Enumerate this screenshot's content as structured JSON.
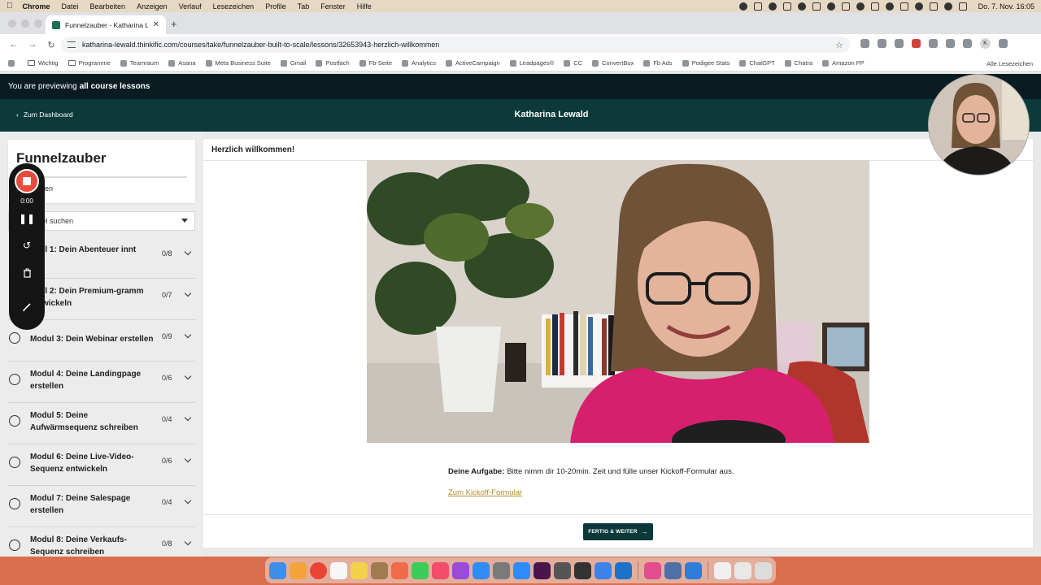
{
  "menubar": {
    "app": "Chrome",
    "items": [
      "Datei",
      "Bearbeiten",
      "Anzeigen",
      "Verlauf",
      "Lesezeichen",
      "Profile",
      "Tab",
      "Fenster",
      "Hilfe"
    ],
    "clock": "Do. 7. Nov. 16:05"
  },
  "browser": {
    "tab_title": "Funnelzauber - Katharina Lew",
    "url": "katharina-lewald.thinkific.com/courses/take/funnelzauber-built-to-scale/lessons/32653943-herzlich-willkommen",
    "bookmarks": [
      "Wichtig",
      "Programme",
      "Teamraum",
      "Asana",
      "Meta Business Suite",
      "Gmail",
      "Postfach",
      "Fb-Seite",
      "Analytics",
      "ActiveCampaign",
      "Leadpages®",
      "CC",
      "ConvertBox",
      "Fb Ads",
      "Podigee Stats",
      "ChatGPT",
      "Chatra",
      "Amazon PP"
    ],
    "all_bookmarks": "Alle Lesezeichen",
    "profile_initial": "K"
  },
  "banner": {
    "prefix": "You are previewing",
    "bold": "all course lessons"
  },
  "header": {
    "back_label": "Zum Dashboard",
    "owner": "Katharina Lewald"
  },
  "sidebar": {
    "course_title": "Funnelzauber",
    "progress_text": "eschlossen",
    "progress_fraction": 0,
    "search_placeholder": "ktionstitel suchen",
    "modules": [
      {
        "title": "odul 1: Dein Abenteuer innt",
        "count": "0/8"
      },
      {
        "title": "odul 2: Dein Premium-gramm entwickeln",
        "count": "0/7"
      },
      {
        "title": "Modul 3: Dein Webinar erstellen",
        "count": "0/9"
      },
      {
        "title": "Modul 4: Deine Landingpage erstellen",
        "count": "0/6"
      },
      {
        "title": "Modul 5: Deine Aufwärmsequenz schreiben",
        "count": "0/4"
      },
      {
        "title": "Modul 6: Deine Live-Video-Sequenz entwickeln",
        "count": "0/6"
      },
      {
        "title": "Modul 7: Deine Salespage erstellen",
        "count": "0/4"
      },
      {
        "title": "Modul 8: Deine Verkaufs-Sequenz schreiben",
        "count": "0/8"
      }
    ]
  },
  "recorder": {
    "time": "0:00"
  },
  "lesson": {
    "title": "Herzlich willkommen!",
    "task_label": "Deine Aufgabe:",
    "task_text": "Bitte nimm dir 10-20min. Zeit und fülle unser Kickoff-Formular aus.",
    "link_text": "Zum Kickoff-Formular",
    "done_button": "FERTIG & WEITER"
  },
  "colors": {
    "header_bg": "#0c3a3a",
    "banner_bg": "#0b1b22",
    "link": "#b38a2f",
    "record_red": "#e84b3c"
  }
}
